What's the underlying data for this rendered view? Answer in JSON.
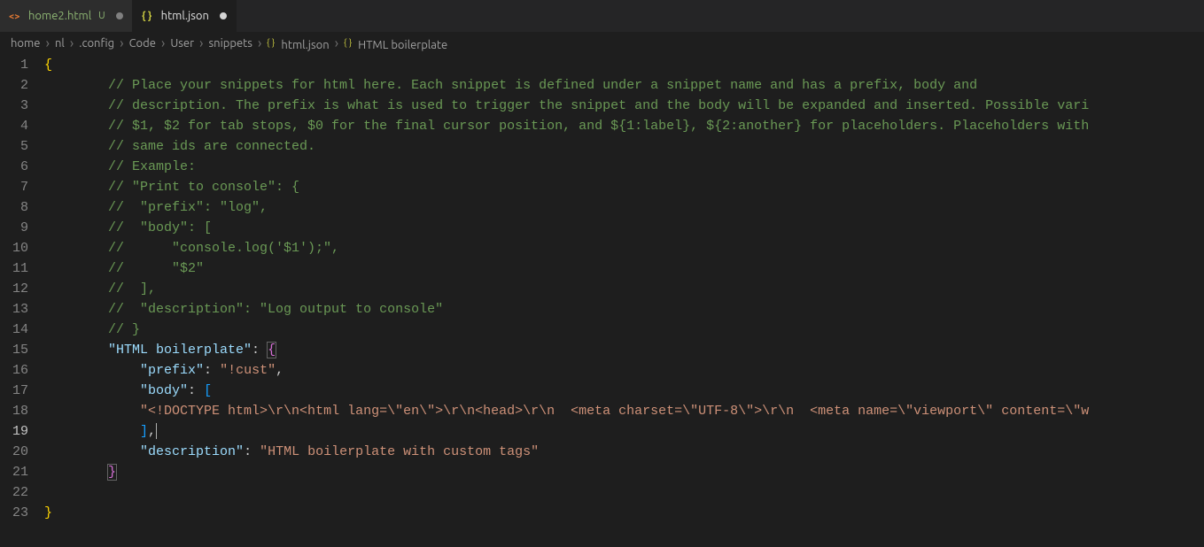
{
  "tabs": [
    {
      "name": "home2.html",
      "status": "U",
      "dirty": true,
      "active": false,
      "iconColor": "#e37933"
    },
    {
      "name": "html.json",
      "status": "",
      "dirty": true,
      "active": true,
      "iconColor": "#cbcb41"
    }
  ],
  "breadcrumbs": [
    {
      "label": "home"
    },
    {
      "label": "nl"
    },
    {
      "label": ".config"
    },
    {
      "label": "Code"
    },
    {
      "label": "User"
    },
    {
      "label": "snippets"
    },
    {
      "label": "html.json",
      "icon": "braces"
    },
    {
      "label": "HTML boilerplate",
      "icon": "braces"
    }
  ],
  "code": {
    "lines": [
      {
        "n": 1,
        "indent": 0,
        "t": [
          {
            "c": "tok-brace",
            "v": "{"
          }
        ]
      },
      {
        "n": 2,
        "indent": 2,
        "t": [
          {
            "c": "tok-comment",
            "v": "// Place your snippets for html here. Each snippet is defined under a snippet name and has a prefix, body and"
          }
        ]
      },
      {
        "n": 3,
        "indent": 2,
        "t": [
          {
            "c": "tok-comment",
            "v": "// description. The prefix is what is used to trigger the snippet and the body will be expanded and inserted. Possible vari"
          }
        ]
      },
      {
        "n": 4,
        "indent": 2,
        "t": [
          {
            "c": "tok-comment",
            "v": "// $1, $2 for tab stops, $0 for the final cursor position, and ${1:label}, ${2:another} for placeholders. Placeholders with"
          }
        ]
      },
      {
        "n": 5,
        "indent": 2,
        "t": [
          {
            "c": "tok-comment",
            "v": "// same ids are connected."
          }
        ]
      },
      {
        "n": 6,
        "indent": 2,
        "t": [
          {
            "c": "tok-comment",
            "v": "// Example:"
          }
        ]
      },
      {
        "n": 7,
        "indent": 2,
        "t": [
          {
            "c": "tok-comment",
            "v": "// \"Print to console\": {"
          }
        ]
      },
      {
        "n": 8,
        "indent": 2,
        "t": [
          {
            "c": "tok-comment",
            "v": "//  \"prefix\": \"log\","
          }
        ]
      },
      {
        "n": 9,
        "indent": 2,
        "t": [
          {
            "c": "tok-comment",
            "v": "//  \"body\": ["
          }
        ]
      },
      {
        "n": 10,
        "indent": 2,
        "t": [
          {
            "c": "tok-comment",
            "v": "//      \"console.log('$1');\","
          }
        ]
      },
      {
        "n": 11,
        "indent": 2,
        "t": [
          {
            "c": "tok-comment",
            "v": "//      \"$2\""
          }
        ]
      },
      {
        "n": 12,
        "indent": 2,
        "t": [
          {
            "c": "tok-comment",
            "v": "//  ],"
          }
        ]
      },
      {
        "n": 13,
        "indent": 2,
        "t": [
          {
            "c": "tok-comment",
            "v": "//  \"description\": \"Log output to console\""
          }
        ]
      },
      {
        "n": 14,
        "indent": 2,
        "t": [
          {
            "c": "tok-comment",
            "v": "// }"
          }
        ]
      },
      {
        "n": 15,
        "indent": 2,
        "t": [
          {
            "c": "tok-key",
            "v": "\"HTML boilerplate\""
          },
          {
            "c": "tok-punct",
            "v": ": "
          },
          {
            "c": "tok-brace2 bracket-box",
            "v": "{"
          }
        ]
      },
      {
        "n": 16,
        "indent": 3,
        "t": [
          {
            "c": "tok-key",
            "v": "\"prefix\""
          },
          {
            "c": "tok-punct",
            "v": ": "
          },
          {
            "c": "tok-string",
            "v": "\"!cust\""
          },
          {
            "c": "tok-punct",
            "v": ","
          }
        ]
      },
      {
        "n": 17,
        "indent": 3,
        "t": [
          {
            "c": "tok-key",
            "v": "\"body\""
          },
          {
            "c": "tok-punct",
            "v": ": "
          },
          {
            "c": "tok-brace3",
            "v": "["
          }
        ]
      },
      {
        "n": 18,
        "indent": 3,
        "t": [
          {
            "c": "tok-string",
            "v": "\"<!DOCTYPE html>\\r\\n<html lang=\\\"en\\\">\\r\\n<head>\\r\\n  <meta charset=\\\"UTF-8\\\">\\r\\n  <meta name=\\\"viewport\\\" content=\\\"w"
          }
        ]
      },
      {
        "n": 19,
        "indent": 3,
        "active": true,
        "t": [
          {
            "c": "tok-brace3",
            "v": "]"
          },
          {
            "c": "tok-punct",
            "v": ","
          },
          {
            "cursor": true
          }
        ]
      },
      {
        "n": 20,
        "indent": 3,
        "t": [
          {
            "c": "tok-key",
            "v": "\"description\""
          },
          {
            "c": "tok-punct",
            "v": ": "
          },
          {
            "c": "tok-string",
            "v": "\"HTML boilerplate with custom tags\""
          }
        ]
      },
      {
        "n": 21,
        "indent": 2,
        "t": [
          {
            "c": "tok-brace2 bracket-box",
            "v": "}"
          }
        ]
      },
      {
        "n": 22,
        "indent": 0,
        "t": []
      },
      {
        "n": 23,
        "indent": 0,
        "t": [
          {
            "c": "tok-brace",
            "v": "}"
          }
        ]
      }
    ]
  }
}
